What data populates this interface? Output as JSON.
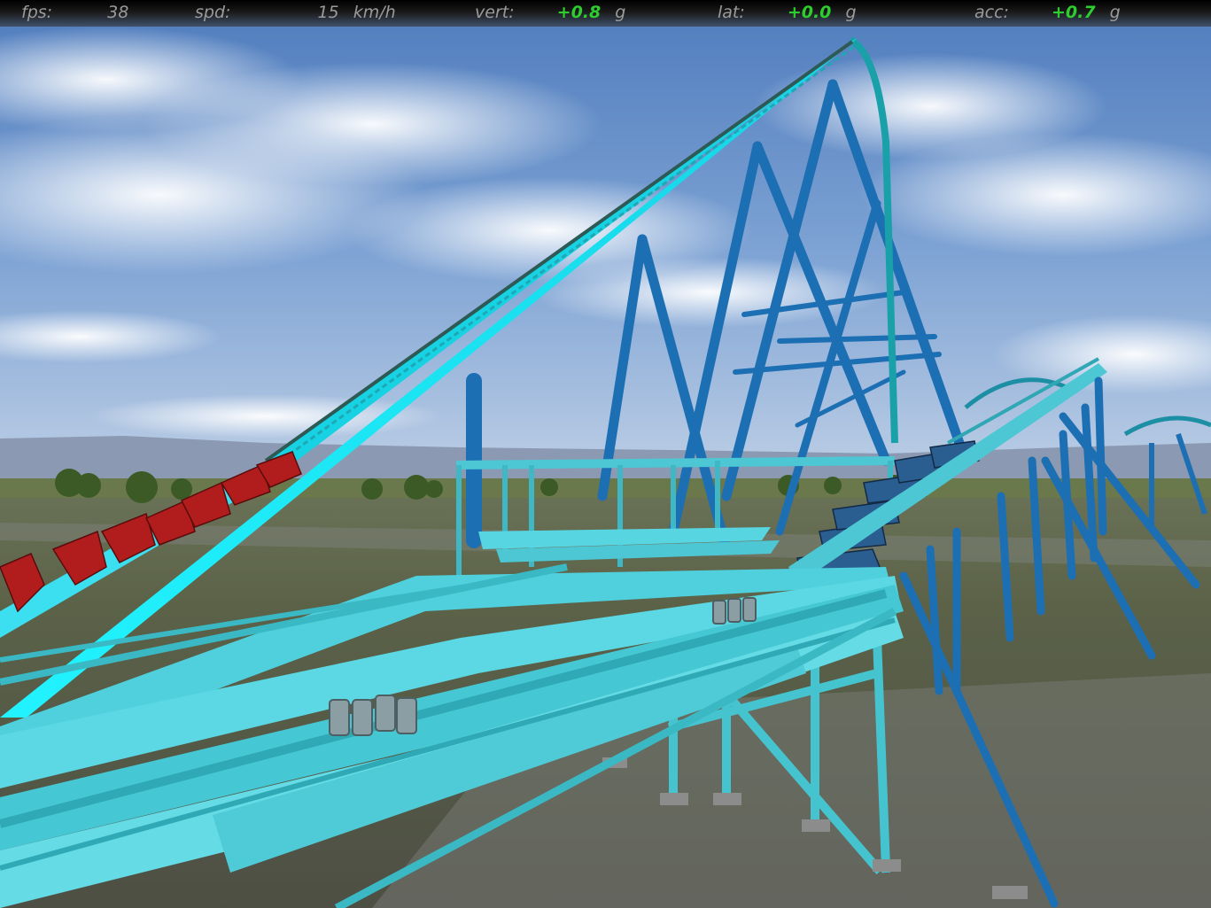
{
  "hud": {
    "fps": {
      "label": "fps:",
      "value": "38"
    },
    "speed": {
      "label": "spd:",
      "value": "15",
      "unit": "km/h"
    },
    "vertical": {
      "label": "vert:",
      "value": "+0.8",
      "unit": "g"
    },
    "lateral": {
      "label": "lat:",
      "value": "+0.0",
      "unit": "g"
    },
    "acceleration": {
      "label": "acc:",
      "value": "+0.7",
      "unit": "g"
    }
  },
  "colors": {
    "sky_top": "#5a85c2",
    "sky_horizon": "#aac2e2",
    "ground": "#5a6048",
    "track_cyan": "#2fe4ef",
    "support_teal": "#4cc7d3",
    "support_blue": "#1d6fb4",
    "train_red": "#b11d1d",
    "hud_label": "#9a9a9a",
    "hud_gforce": "#2ecc2e"
  },
  "scene": {
    "lift_hill": "lift-hill",
    "station": "station",
    "train_on_lift": "coaster-train-red",
    "train_in_station": "coaster-train-blue"
  }
}
